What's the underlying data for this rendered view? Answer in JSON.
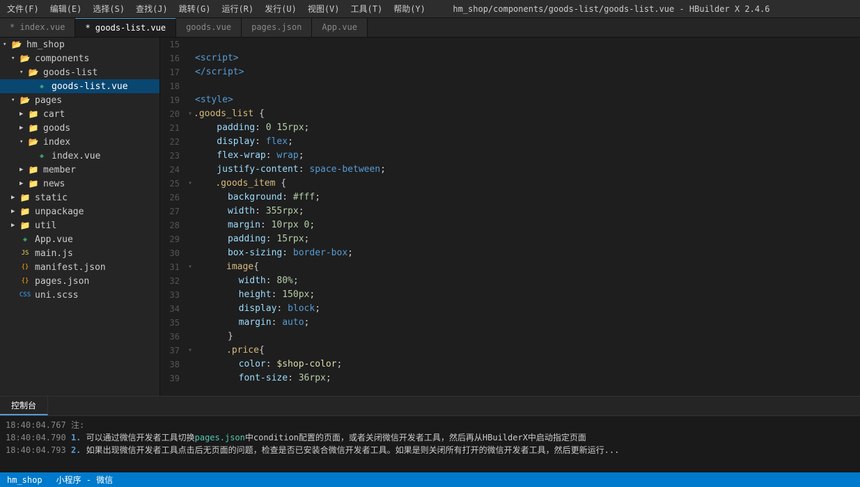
{
  "titleBar": {
    "menus": [
      "文件(F)",
      "编辑(E)",
      "选择(S)",
      "查找(J)",
      "跳转(G)",
      "运行(R)",
      "发行(U)",
      "视图(V)",
      "工具(T)",
      "帮助(Y)"
    ],
    "title": "hm_shop/components/goods-list/goods-list.vue - HBuilder X 2.4.6"
  },
  "tabs": [
    {
      "label": "* index.vue",
      "active": false
    },
    {
      "label": "* goods-list.vue",
      "active": true
    },
    {
      "label": "goods.vue",
      "active": false
    },
    {
      "label": "pages.json",
      "active": false
    },
    {
      "label": "App.vue",
      "active": false
    }
  ],
  "sidebar": {
    "items": [
      {
        "indent": 0,
        "type": "folder-open",
        "label": "hm_shop",
        "arrow": "▾"
      },
      {
        "indent": 1,
        "type": "folder-open",
        "label": "components",
        "arrow": "▾"
      },
      {
        "indent": 2,
        "type": "folder-open",
        "label": "goods-list",
        "arrow": "▾"
      },
      {
        "indent": 3,
        "type": "file-vue",
        "label": "goods-list.vue",
        "selected": true
      },
      {
        "indent": 1,
        "type": "folder-open",
        "label": "pages",
        "arrow": "▾"
      },
      {
        "indent": 2,
        "type": "folder-closed",
        "label": "cart",
        "arrow": "▶"
      },
      {
        "indent": 2,
        "type": "folder-closed",
        "label": "goods",
        "arrow": "▶"
      },
      {
        "indent": 2,
        "type": "folder-open",
        "label": "index",
        "arrow": "▾"
      },
      {
        "indent": 3,
        "type": "file-vue",
        "label": "index.vue"
      },
      {
        "indent": 2,
        "type": "folder-closed",
        "label": "member",
        "arrow": "▶"
      },
      {
        "indent": 2,
        "type": "folder-closed",
        "label": "news",
        "arrow": "▶"
      },
      {
        "indent": 1,
        "type": "folder-closed",
        "label": "static",
        "arrow": "▶"
      },
      {
        "indent": 1,
        "type": "folder-closed",
        "label": "unpackage",
        "arrow": "▶"
      },
      {
        "indent": 1,
        "type": "folder-closed",
        "label": "util",
        "arrow": "▶"
      },
      {
        "indent": 1,
        "type": "file-vue",
        "label": "App.vue"
      },
      {
        "indent": 1,
        "type": "file-js",
        "label": "main.js"
      },
      {
        "indent": 1,
        "type": "file-json",
        "label": "manifest.json"
      },
      {
        "indent": 1,
        "type": "file-json",
        "label": "pages.json"
      },
      {
        "indent": 1,
        "type": "file-css",
        "label": "uni.scss"
      }
    ]
  },
  "editor": {
    "lines": [
      {
        "num": 15,
        "content": ""
      },
      {
        "num": 16,
        "tokens": [
          {
            "t": "tag",
            "v": "<script"
          },
          {
            "t": "tag",
            "v": ">"
          }
        ]
      },
      {
        "num": 17,
        "tokens": [
          {
            "t": "tag",
            "v": "</script"
          },
          {
            "t": "tag",
            "v": ">"
          }
        ]
      },
      {
        "num": 18,
        "content": ""
      },
      {
        "num": 19,
        "tokens": [
          {
            "t": "tag",
            "v": "<style"
          },
          {
            "t": "tag",
            "v": ">"
          }
        ]
      },
      {
        "num": 20,
        "tokens": [
          {
            "t": "selector",
            "v": ".goods_list"
          },
          {
            "t": "punc",
            "v": " {"
          }
        ],
        "collapse": true
      },
      {
        "num": 21,
        "tokens": [
          {
            "t": "property",
            "v": "    padding"
          },
          {
            "t": "colon",
            "v": ": "
          },
          {
            "t": "value-num",
            "v": "0 15rpx"
          },
          {
            "t": "punc",
            "v": ";"
          }
        ]
      },
      {
        "num": 22,
        "tokens": [
          {
            "t": "property",
            "v": "    display"
          },
          {
            "t": "colon",
            "v": ": "
          },
          {
            "t": "kw",
            "v": "flex"
          },
          {
            "t": "punc",
            "v": ";"
          }
        ]
      },
      {
        "num": 23,
        "tokens": [
          {
            "t": "property",
            "v": "    flex-wrap"
          },
          {
            "t": "colon",
            "v": ": "
          },
          {
            "t": "kw",
            "v": "wrap"
          },
          {
            "t": "punc",
            "v": ";"
          }
        ]
      },
      {
        "num": 24,
        "tokens": [
          {
            "t": "property",
            "v": "    justify-content"
          },
          {
            "t": "colon",
            "v": ": "
          },
          {
            "t": "kw",
            "v": "space-between"
          },
          {
            "t": "punc",
            "v": ";"
          }
        ]
      },
      {
        "num": 25,
        "tokens": [
          {
            "t": "selector",
            "v": "    .goods_item"
          },
          {
            "t": "punc",
            "v": " {"
          }
        ],
        "collapse": true
      },
      {
        "num": 26,
        "tokens": [
          {
            "t": "property",
            "v": "      background"
          },
          {
            "t": "colon",
            "v": ": "
          },
          {
            "t": "value-color",
            "v": "#fff"
          },
          {
            "t": "punc",
            "v": ";"
          }
        ]
      },
      {
        "num": 27,
        "tokens": [
          {
            "t": "property",
            "v": "      width"
          },
          {
            "t": "colon",
            "v": ": "
          },
          {
            "t": "value-num",
            "v": "355rpx"
          },
          {
            "t": "punc",
            "v": ";"
          }
        ]
      },
      {
        "num": 28,
        "tokens": [
          {
            "t": "property",
            "v": "      margin"
          },
          {
            "t": "colon",
            "v": ": "
          },
          {
            "t": "value-num",
            "v": "10rpx 0"
          },
          {
            "t": "punc",
            "v": ";"
          }
        ]
      },
      {
        "num": 29,
        "tokens": [
          {
            "t": "property",
            "v": "      padding"
          },
          {
            "t": "colon",
            "v": ": "
          },
          {
            "t": "value-num",
            "v": "15rpx"
          },
          {
            "t": "punc",
            "v": ";"
          }
        ]
      },
      {
        "num": 30,
        "tokens": [
          {
            "t": "property",
            "v": "      box-sizing"
          },
          {
            "t": "colon",
            "v": ": "
          },
          {
            "t": "kw",
            "v": "border-box"
          },
          {
            "t": "punc",
            "v": ";"
          }
        ]
      },
      {
        "num": 31,
        "tokens": [
          {
            "t": "selector",
            "v": "      image"
          },
          {
            "t": "punc",
            "v": "{"
          }
        ],
        "collapse": true
      },
      {
        "num": 32,
        "tokens": [
          {
            "t": "property",
            "v": "        width"
          },
          {
            "t": "colon",
            "v": ": "
          },
          {
            "t": "value-num",
            "v": "80%"
          },
          {
            "t": "punc",
            "v": ";"
          }
        ]
      },
      {
        "num": 33,
        "tokens": [
          {
            "t": "property",
            "v": "        height"
          },
          {
            "t": "colon",
            "v": ": "
          },
          {
            "t": "value-num",
            "v": "150px"
          },
          {
            "t": "punc",
            "v": ";"
          }
        ]
      },
      {
        "num": 34,
        "tokens": [
          {
            "t": "property",
            "v": "        display"
          },
          {
            "t": "colon",
            "v": ": "
          },
          {
            "t": "kw",
            "v": "block"
          },
          {
            "t": "punc",
            "v": ";"
          }
        ]
      },
      {
        "num": 35,
        "tokens": [
          {
            "t": "property",
            "v": "        margin"
          },
          {
            "t": "colon",
            "v": ": "
          },
          {
            "t": "kw",
            "v": "auto"
          },
          {
            "t": "punc",
            "v": ";"
          }
        ]
      },
      {
        "num": 36,
        "tokens": [
          {
            "t": "punc",
            "v": "      }"
          }
        ]
      },
      {
        "num": 37,
        "tokens": [
          {
            "t": "selector",
            "v": "      .price"
          },
          {
            "t": "punc",
            "v": "{"
          }
        ],
        "collapse": true
      },
      {
        "num": 38,
        "tokens": [
          {
            "t": "property",
            "v": "        color"
          },
          {
            "t": "colon",
            "v": ": "
          },
          {
            "t": "value-func",
            "v": "$shop-color"
          },
          {
            "t": "punc",
            "v": ";"
          }
        ]
      },
      {
        "num": 39,
        "tokens": [
          {
            "t": "property",
            "v": "        font-size"
          },
          {
            "t": "colon",
            "v": ": "
          },
          {
            "t": "value-num",
            "v": "36rpx"
          },
          {
            "t": "punc",
            "v": ";"
          }
        ]
      }
    ]
  },
  "bottomPanel": {
    "tabs": [
      "控制台"
    ],
    "logs": [
      {
        "time": "18:40:04.767",
        "level": "注:",
        "text": ""
      },
      {
        "time": "18:40:04.790",
        "num": "1.",
        "text": " 可以通过微信开发者工具切换",
        "highlight": "pages.json",
        "text2": "中condition配置的页面，或者关闭微信开发者工具，然后再从HBuilderX中启动指定页面"
      },
      {
        "time": "18:40:04.793",
        "num": "2.",
        "text": " 如果出现微信开发者工具点击后无页面的问题，检查是否已安装合微信开发者工具。如果是则关闭所有打开的微信开发者工具，然后更新运行..."
      }
    ]
  },
  "statusBar": {
    "project": "hm_shop",
    "type": "小程序 - 微信"
  }
}
